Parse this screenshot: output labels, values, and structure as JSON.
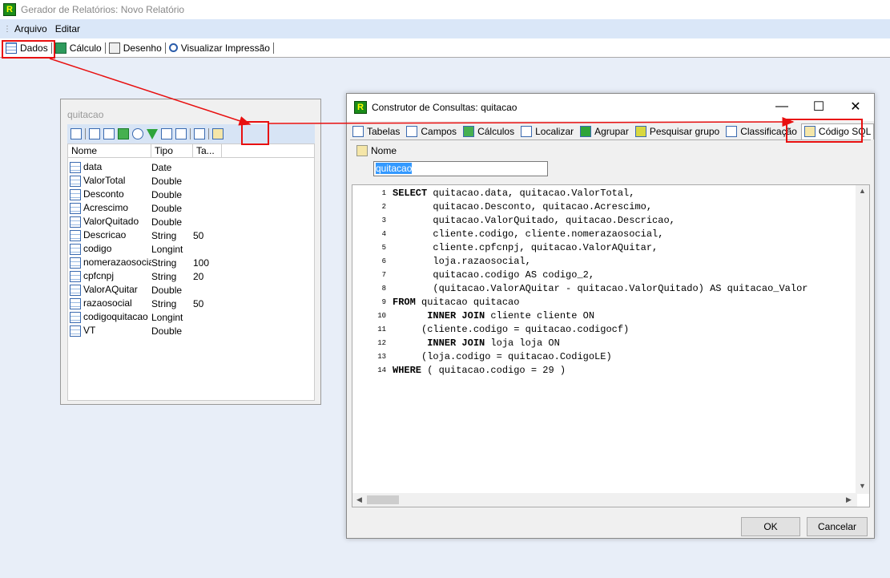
{
  "window": {
    "title": "Gerador de Relatórios: Novo Relatório",
    "icon_letter": "R"
  },
  "menu": [
    "Arquivo",
    "Editar"
  ],
  "toolbar": [
    {
      "label": "Dados",
      "icon": "table-icon"
    },
    {
      "label": "Cálculo",
      "icon": "calculator-icon"
    },
    {
      "label": "Desenho",
      "icon": "pencil-icon"
    },
    {
      "label": "Visualizar Impressão",
      "icon": "print-preview-icon"
    }
  ],
  "panel": {
    "title": "quitacao",
    "columns": [
      "Nome",
      "Tipo",
      "Ta..."
    ],
    "fields": [
      {
        "name": "data",
        "type": "Date",
        "size": ""
      },
      {
        "name": "ValorTotal",
        "type": "Double",
        "size": ""
      },
      {
        "name": "Desconto",
        "type": "Double",
        "size": ""
      },
      {
        "name": "Acrescimo",
        "type": "Double",
        "size": ""
      },
      {
        "name": "ValorQuitado",
        "type": "Double",
        "size": ""
      },
      {
        "name": "Descricao",
        "type": "String",
        "size": "50"
      },
      {
        "name": "codigo",
        "type": "Longint",
        "size": ""
      },
      {
        "name": "nomerazaosocial",
        "type": "String",
        "size": "100"
      },
      {
        "name": "cpfcnpj",
        "type": "String",
        "size": "20"
      },
      {
        "name": "ValorAQuitar",
        "type": "Double",
        "size": ""
      },
      {
        "name": "razaosocial",
        "type": "String",
        "size": "50"
      },
      {
        "name": "codigoquitacao",
        "type": "Longint",
        "size": ""
      },
      {
        "name": "VT",
        "type": "Double",
        "size": ""
      }
    ]
  },
  "dialog": {
    "title": "Construtor de Consultas: quitacao",
    "tabs": [
      {
        "label": "Tabelas",
        "icon": "table-icon"
      },
      {
        "label": "Campos",
        "icon": "fields-icon"
      },
      {
        "label": "Cálculos",
        "icon": "calculator-icon"
      },
      {
        "label": "Localizar",
        "icon": "search-icon"
      },
      {
        "label": "Agrupar",
        "icon": "filter-icon"
      },
      {
        "label": "Pesquisar grupo",
        "icon": "group-search-icon"
      },
      {
        "label": "Classificação",
        "icon": "sort-icon"
      },
      {
        "label": "Código SQL",
        "icon": "sql-code-icon"
      }
    ],
    "name_label": "Nome",
    "name_value": "quitacao",
    "sql_lines": [
      {
        "n": "1",
        "kw": "SELECT",
        "text": " quitacao.data, quitacao.ValorTotal,"
      },
      {
        "n": "2",
        "kw": "",
        "text": "       quitacao.Desconto, quitacao.Acrescimo,"
      },
      {
        "n": "3",
        "kw": "",
        "text": "       quitacao.ValorQuitado, quitacao.Descricao,"
      },
      {
        "n": "4",
        "kw": "",
        "text": "       cliente.codigo, cliente.nomerazaosocial,"
      },
      {
        "n": "5",
        "kw": "",
        "text": "       cliente.cpfcnpj, quitacao.ValorAQuitar,"
      },
      {
        "n": "6",
        "kw": "",
        "text": "       loja.razaosocial,"
      },
      {
        "n": "7",
        "kw": "",
        "text": "       quitacao.codigo AS codigo_2,"
      },
      {
        "n": "8",
        "kw": "",
        "text": "       (quitacao.ValorAQuitar - quitacao.ValorQuitado) AS quitacao_Valor"
      },
      {
        "n": "9",
        "kw": "FROM",
        "text": " quitacao quitacao"
      },
      {
        "n": "10",
        "kw": "      INNER JOIN",
        "text": " cliente cliente ON"
      },
      {
        "n": "11",
        "kw": "",
        "text": "     (cliente.codigo = quitacao.codigocf)"
      },
      {
        "n": "12",
        "kw": "      INNER JOIN",
        "text": " loja loja ON"
      },
      {
        "n": "13",
        "kw": "",
        "text": "     (loja.codigo = quitacao.CodigoLE)"
      },
      {
        "n": "14",
        "kw": "WHERE",
        "text": " ( quitacao.codigo = 29 )"
      }
    ],
    "ok_label": "OK",
    "cancel_label": "Cancelar"
  },
  "colors": {
    "highlight": "#e81010",
    "selection": "#3399ff"
  }
}
